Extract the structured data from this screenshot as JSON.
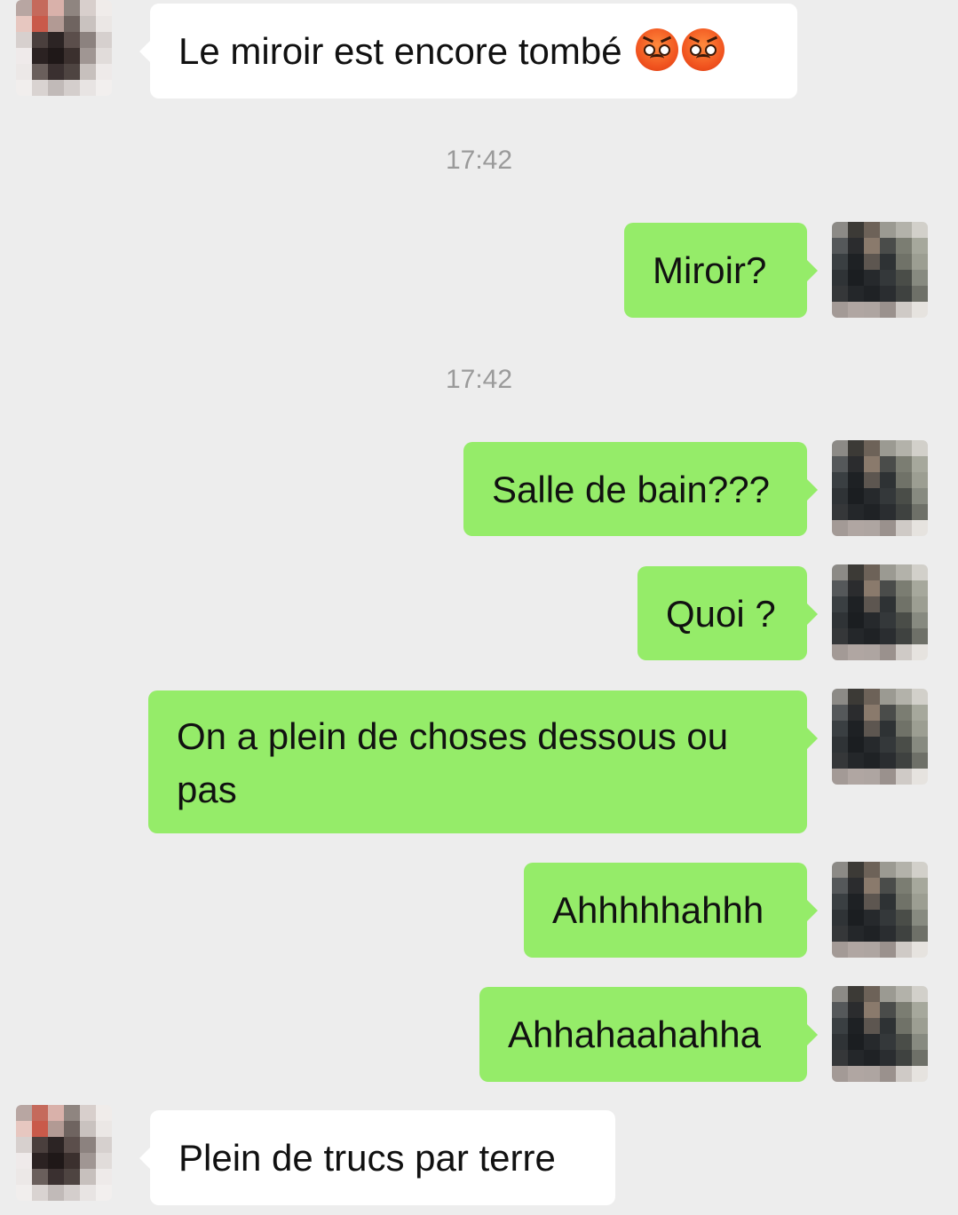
{
  "conversation": {
    "messages": [
      {
        "direction": "incoming",
        "text": "Le miroir est encore tombé",
        "emoji": [
          "pouting-face-icon",
          "pouting-face-icon"
        ]
      },
      {
        "direction": "timestamp",
        "text": "17:42"
      },
      {
        "direction": "outgoing",
        "text": "Miroir?"
      },
      {
        "direction": "timestamp",
        "text": "17:42"
      },
      {
        "direction": "outgoing",
        "text": "Salle de bain???"
      },
      {
        "direction": "outgoing",
        "text": "Quoi ?"
      },
      {
        "direction": "outgoing",
        "text": "On a plein de choses dessous ou pas"
      },
      {
        "direction": "outgoing",
        "text": "Ahhhhhahhh"
      },
      {
        "direction": "outgoing",
        "text": "Ahhahaahahha"
      },
      {
        "direction": "incoming",
        "text": "Plein de trucs par terre"
      }
    ]
  },
  "colors": {
    "background": "#ededed",
    "incoming_bubble": "#ffffff",
    "outgoing_bubble": "#95ec69",
    "timestamp_text": "#9a9a9a"
  }
}
